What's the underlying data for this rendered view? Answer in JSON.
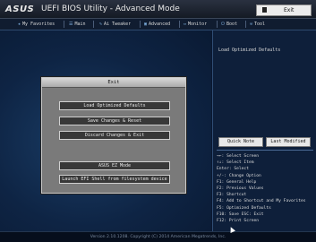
{
  "header": {
    "logo": "ASUS",
    "title": "UEFI BIOS Utility - Advanced Mode",
    "exit_label": "Exit"
  },
  "tabs": [
    {
      "label": "My Favorites",
      "icon": "star-icon"
    },
    {
      "label": "Main",
      "icon": "list-icon"
    },
    {
      "label": "Ai Tweaker",
      "icon": "wrench-icon"
    },
    {
      "label": "Advanced",
      "icon": "advanced-icon"
    },
    {
      "label": "Monitor",
      "icon": "monitor-icon"
    },
    {
      "label": "Boot",
      "icon": "power-icon"
    },
    {
      "label": "Tool",
      "icon": "tool-icon"
    }
  ],
  "help_text": "Load Optimized Defaults",
  "quick_note_label": "Quick Note",
  "last_modified_label": "Last Modified",
  "key_help": [
    "→←: Select Screen",
    "↑↓: Select Item",
    "Enter: Select",
    "+/-: Change Option",
    "F1: General Help",
    "F2: Previous Values",
    "F3: Shortcut",
    "F4: Add to Shortcut and My Favorites",
    "F5: Optimized Defaults",
    "F10: Save  ESC: Exit",
    "F12: Print Screen"
  ],
  "dialog": {
    "title": "Exit",
    "options": [
      "Load Optimized Defaults",
      "Save Changes & Reset",
      "Discard Changes & Exit",
      "ASUS EZ Mode",
      "Launch EFI Shell from filesystem device"
    ]
  },
  "footer": {
    "version": "Version 2.10.1208. Copyright (C) 2014 American Megatrends, Inc."
  }
}
